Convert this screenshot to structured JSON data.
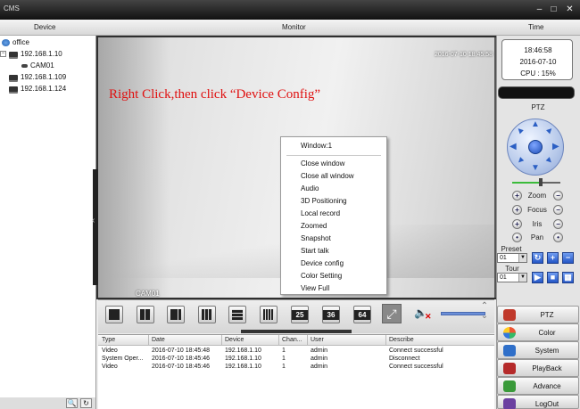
{
  "window": {
    "title": "CMS",
    "minimize": "–",
    "maximize": "□",
    "close": "✕"
  },
  "header": {
    "device": "Device",
    "monitor": "Monitor",
    "time": "Time"
  },
  "device_tree": {
    "group": "office",
    "devices": [
      {
        "ip": "192.168.1.10",
        "expanded": true,
        "channels": [
          "CAM01"
        ]
      },
      {
        "ip": "192.168.1.109"
      },
      {
        "ip": "192.168.1.124"
      }
    ],
    "bottom_buttons": [
      "🔍",
      "↻"
    ]
  },
  "video": {
    "osd_timestamp": "2016-07-10 18:45:58",
    "channel_label": "CAM01",
    "instruction": "Right Click,then click “Device Config”"
  },
  "context_menu": {
    "header": "Window:1",
    "items": [
      "Close window",
      "Close all window",
      "Audio",
      "3D Positioning",
      "Local record",
      "Zoomed",
      "Snapshot",
      "Start talk",
      "Device config",
      "Color Setting",
      "View Full"
    ]
  },
  "layout_toolbar": {
    "buttons": [
      "1",
      "4",
      "6",
      "9",
      "8",
      "16",
      "25",
      "36",
      "64"
    ]
  },
  "log": {
    "columns": [
      "Type",
      "Date",
      "Device",
      "Chan...",
      "User",
      "Describe"
    ],
    "rows": [
      {
        "type": "Video",
        "date": "2016-07-10 18:45:48",
        "device": "192.168.1.10",
        "channel": "1",
        "user": "admin",
        "describe": "Connect successful"
      },
      {
        "type": "System Oper...",
        "date": "2016-07-10 18:45:46",
        "device": "192.168.1.10",
        "channel": "1",
        "user": "admin",
        "describe": "Disconnect"
      },
      {
        "type": "Video",
        "date": "2016-07-10 18:45:46",
        "device": "192.168.1.10",
        "channel": "1",
        "user": "admin",
        "describe": "Connect successful"
      }
    ]
  },
  "clock": {
    "time": "18:46:58",
    "date": "2016-07-10",
    "cpu": "CPU : 15%"
  },
  "ptz": {
    "title": "PTZ",
    "controls": [
      "Zoom",
      "Focus",
      "Iris",
      "Pan"
    ],
    "preset_label": "Preset",
    "preset_value": "01",
    "tour_label": "Tour",
    "tour_value": "01",
    "speed_fraction": 0.6
  },
  "nav": {
    "items": [
      {
        "label": "PTZ",
        "icon": "ptz-icon",
        "color": "#c0392b"
      },
      {
        "label": "Color",
        "icon": "color-icon",
        "color": "#d94b2b"
      },
      {
        "label": "System",
        "icon": "system-icon",
        "color": "#2f6fc9"
      },
      {
        "label": "PlayBack",
        "icon": "playback-icon",
        "color": "#b52a2a"
      },
      {
        "label": "Advance",
        "icon": "advance-icon",
        "color": "#3a9a3a"
      },
      {
        "label": "LogOut",
        "icon": "logout-icon",
        "color": "#6b3fa0"
      }
    ]
  },
  "colors": {
    "instruction_text": "#e01010",
    "ptz_blue": "#2b5fc4"
  }
}
